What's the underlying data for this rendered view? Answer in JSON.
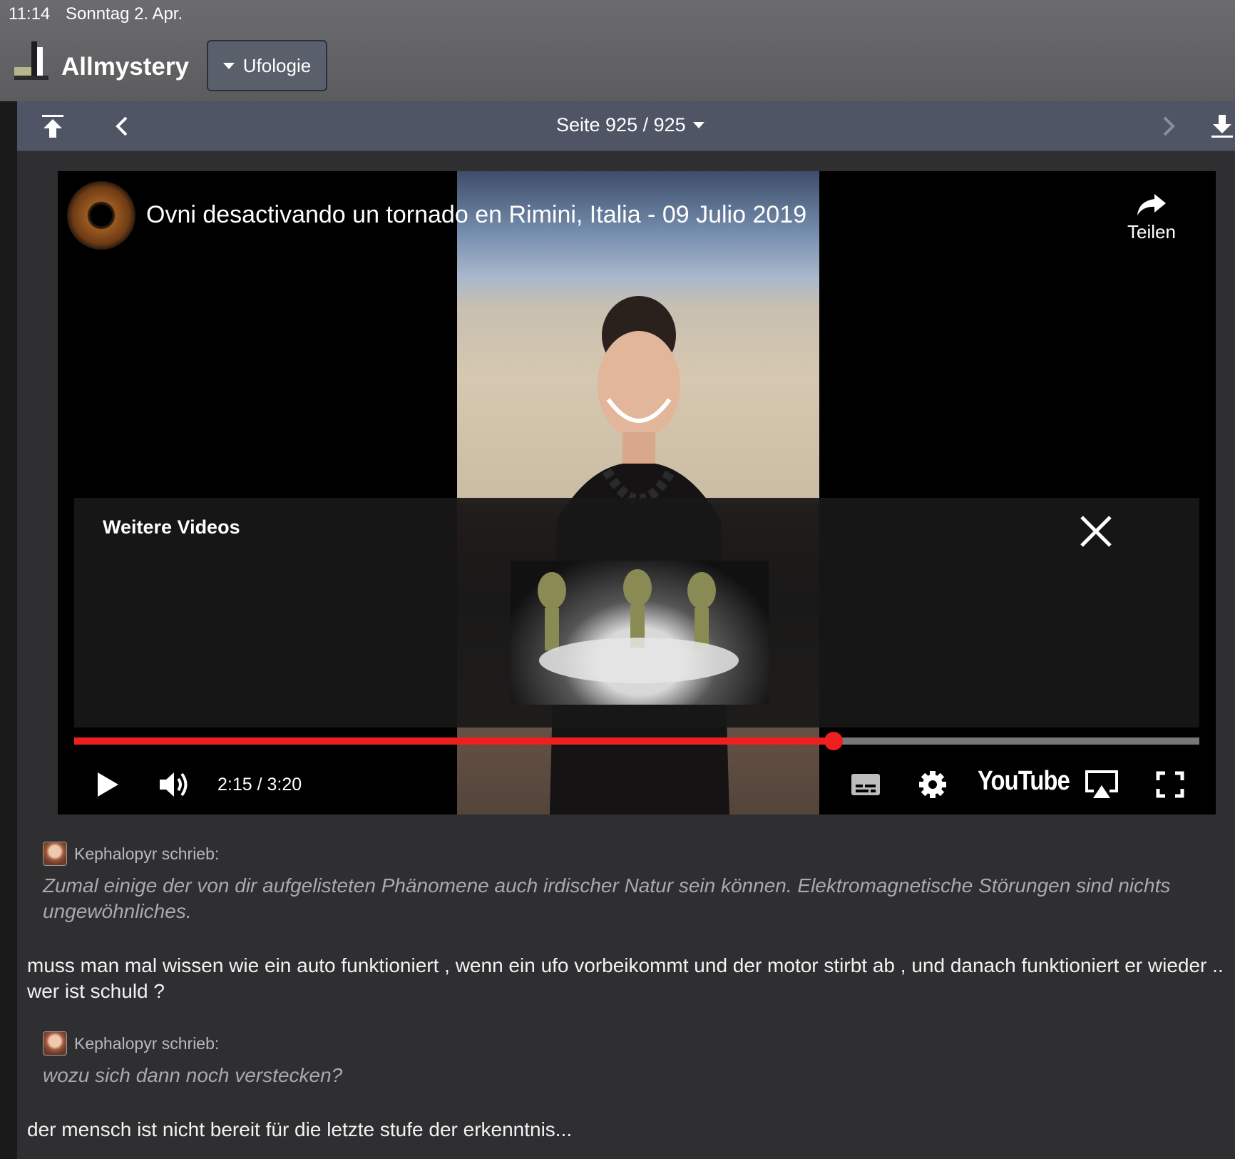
{
  "status": {
    "time": "11:14",
    "date": "Sonntag 2. Apr."
  },
  "app": {
    "brand": "Allmystery",
    "forum": "Ufologie"
  },
  "pager": {
    "label": "Seite 925 / 925"
  },
  "video": {
    "title": "Ovni desactivando un tornado en Rimini, Italia - 09 Julio 2019",
    "share_label": "Teilen",
    "more_title": "Weitere Videos",
    "time": "2:15 / 3:20",
    "progress": 0.675,
    "logo": "YouTube"
  },
  "quotes": [
    {
      "author": "Kephalopyr schrieb:",
      "text": "Zumal einige der von dir aufgelisteten Phänomene auch irdischer Natur sein können. Elektromagnetische Störungen sind nichts ungewöhnliches."
    },
    {
      "author": "Kephalopyr schrieb:",
      "text": "wozu sich dann noch verstecken?"
    }
  ],
  "replies": [
    "muss man mal wissen wie ein auto funktioniert , wenn ein ufo vorbeikommt und der motor stirbt ab , und danach funktioniert er wieder .. wer ist schuld ?",
    "der mensch ist nicht bereit für die letzte stufe der erkenntnis..."
  ],
  "colors": {
    "accent": "#ee1f1f",
    "pager_bg": "#4f5565",
    "page_bg": "#2f2f31"
  }
}
